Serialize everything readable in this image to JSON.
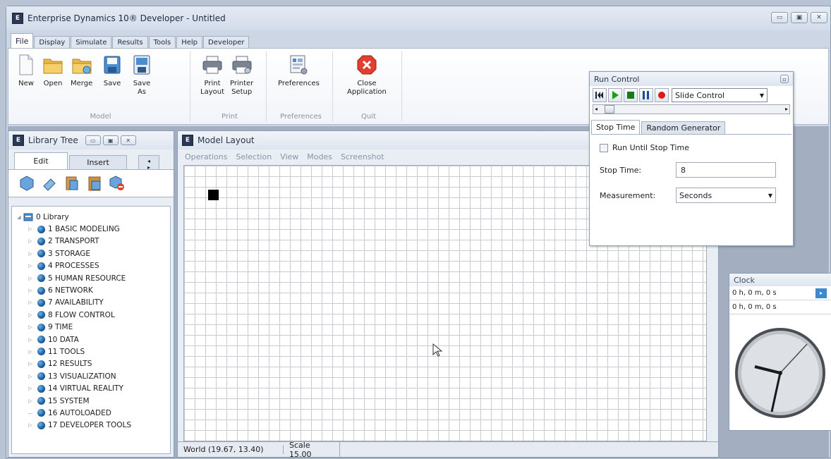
{
  "window": {
    "title": "Enterprise Dynamics 10® Developer -  Untitled"
  },
  "ribbon_tabs": [
    "File",
    "Display",
    "Simulate",
    "Results",
    "Tools",
    "Help",
    "Developer"
  ],
  "ribbon": {
    "groups": {
      "model": "Model",
      "print": "Print",
      "preferences": "Preferences",
      "quit": "Quit"
    },
    "buttons": {
      "new": "New",
      "open": "Open",
      "merge": "Merge",
      "save": "Save",
      "save_as_1": "Save",
      "save_as_2": "As",
      "print_layout_1": "Print",
      "print_layout_2": "Layout",
      "printer_setup_1": "Printer",
      "printer_setup_2": "Setup",
      "preferences": "Preferences",
      "close_app_1": "Close",
      "close_app_2": "Application"
    }
  },
  "library_tree": {
    "title": "Library Tree",
    "tabs": [
      "Edit",
      "Insert"
    ],
    "root": "0 Library",
    "items": [
      "1 BASIC MODELING",
      "2 TRANSPORT",
      "3 STORAGE",
      "4 PROCESSES",
      "5 HUMAN RESOURCE",
      "6 NETWORK",
      "7 AVAILABILITY",
      "8 FLOW CONTROL",
      "9 TIME",
      "10 DATA",
      "11 TOOLS",
      "12 RESULTS",
      "13 VISUALIZATION",
      "14 VIRTUAL REALITY",
      "15 SYSTEM",
      "16 AUTOLOADED",
      "17 DEVELOPER TOOLS"
    ]
  },
  "model_layout": {
    "title": "Model Layout",
    "menu": [
      "Operations",
      "Selection",
      "View",
      "Modes",
      "Screenshot"
    ],
    "status_world": "World (19.67, 13.40)",
    "status_scale": "Scale 15.00"
  },
  "run_control": {
    "title": "Run Control",
    "speed_mode": "Slide Control",
    "tabs": [
      "Stop Time",
      "Random Generator"
    ],
    "run_until_label": "Run Until Stop Time",
    "stop_time_label": "Stop Time:",
    "stop_time_value": "8",
    "measurement_label": "Measurement:",
    "measurement_value": "Seconds"
  },
  "clock": {
    "title": "Clock",
    "time_1": "0 h, 0 m, 0 s",
    "time_2": "0 h, 0 m, 0 s"
  },
  "colors": {
    "accent": "#1c5c9a",
    "record": "#e01818",
    "play": "#1aa01a"
  }
}
